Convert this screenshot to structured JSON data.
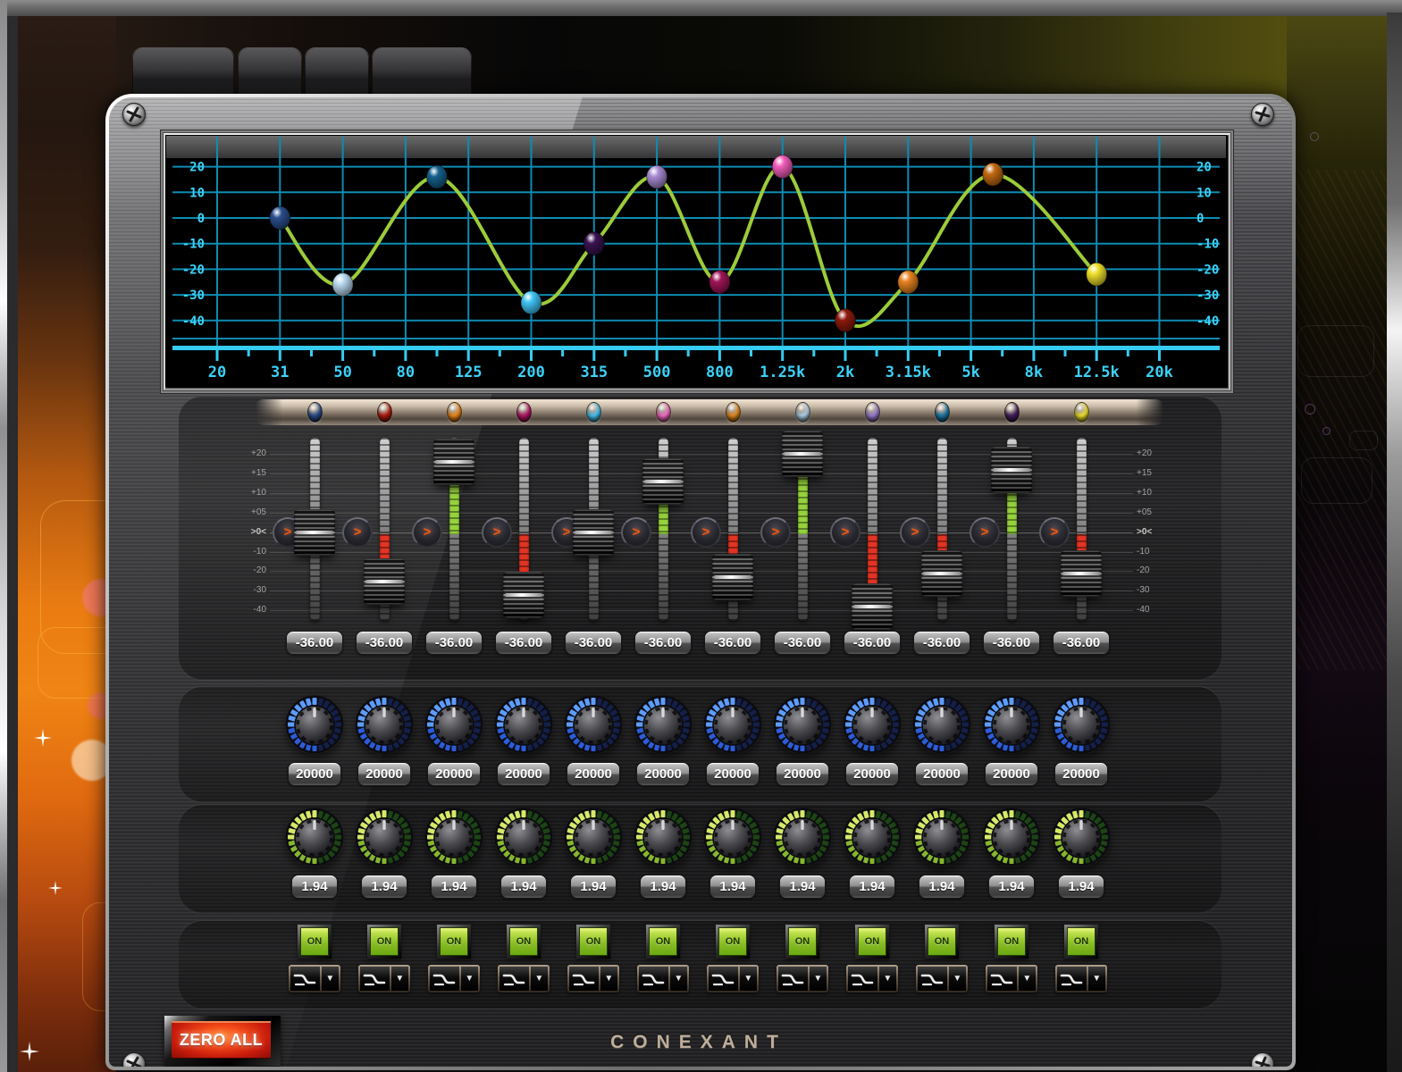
{
  "window": {
    "tabs": [
      {
        "label": ""
      },
      {
        "label": ""
      },
      {
        "label": ""
      },
      {
        "label": ""
      }
    ],
    "zero_all_label": "ZERO ALL",
    "brand": "CONEXANT"
  },
  "eq_scale": {
    "labels": [
      "+20",
      "+15",
      "+10",
      "+05",
      ">0<",
      "-10",
      "-20",
      "-30",
      "-40"
    ]
  },
  "chart_data": {
    "type": "line",
    "title": "",
    "xlabel": "",
    "ylabel": "",
    "x_ticks": [
      "20",
      "31",
      "50",
      "80",
      "125",
      "200",
      "315",
      "500",
      "800",
      "1.25k",
      "2k",
      "3.15k",
      "5k",
      "8k",
      "12.5k",
      "20k"
    ],
    "y_ticks": [
      "20",
      "10",
      "0",
      "-10",
      "-20",
      "-30",
      "-40"
    ],
    "ylim": [
      -50,
      30
    ],
    "grid": true,
    "legend": false,
    "curve_color": "#9ccc3a",
    "grid_color": "#0d8cb2",
    "axis_color": "#35ccf2",
    "label_color": "#3cd2f8",
    "points": [
      {
        "freq": "31",
        "tick": 1,
        "db": 0,
        "color": "#2a4e8c"
      },
      {
        "freq": "50",
        "tick": 2,
        "db": -26,
        "color": "#b8d8ee"
      },
      {
        "freq": "100",
        "tick": 3.5,
        "db": 16,
        "color": "#15608c"
      },
      {
        "freq": "200",
        "tick": 5,
        "db": -33,
        "color": "#40c4f4"
      },
      {
        "freq": "315",
        "tick": 6,
        "db": -10,
        "color": "#3a1252"
      },
      {
        "freq": "500",
        "tick": 7,
        "db": 16,
        "color": "#a88ad2"
      },
      {
        "freq": "800",
        "tick": 8,
        "db": -25,
        "color": "#a01458"
      },
      {
        "freq": "1.25k",
        "tick": 9,
        "db": 20,
        "color": "#f25cba"
      },
      {
        "freq": "2k",
        "tick": 10,
        "db": -40,
        "color": "#8c1a0c"
      },
      {
        "freq": "3.15k",
        "tick": 11,
        "db": -25,
        "color": "#e6821e"
      },
      {
        "freq": "6.3k",
        "tick": 12.35,
        "db": 17,
        "color": "#c26a12"
      },
      {
        "freq": "12.5k",
        "tick": 14,
        "db": -22,
        "color": "#eee02a"
      }
    ]
  },
  "bands": [
    {
      "id": 1,
      "led_color": "#2a4e8c",
      "slider_db": 0,
      "gain": "-36.00",
      "freq": "20000",
      "q": "1.94",
      "power": "ON"
    },
    {
      "id": 2,
      "led_color": "#b41c10",
      "slider_db": -25,
      "gain": "-36.00",
      "freq": "20000",
      "q": "1.94",
      "power": "ON"
    },
    {
      "id": 3,
      "led_color": "#f08818",
      "slider_db": 18,
      "gain": "-36.00",
      "freq": "20000",
      "q": "1.94",
      "power": "ON"
    },
    {
      "id": 4,
      "led_color": "#b61668",
      "slider_db": -32,
      "gain": "-36.00",
      "freq": "20000",
      "q": "1.94",
      "power": "ON"
    },
    {
      "id": 5,
      "led_color": "#46c2f2",
      "slider_db": 0,
      "gain": "-36.00",
      "freq": "20000",
      "q": "1.94",
      "power": "ON"
    },
    {
      "id": 6,
      "led_color": "#f66cc4",
      "slider_db": 13,
      "gain": "-36.00",
      "freq": "20000",
      "q": "1.94",
      "power": "ON"
    },
    {
      "id": 7,
      "led_color": "#e08a20",
      "slider_db": -23,
      "gain": "-36.00",
      "freq": "20000",
      "q": "1.94",
      "power": "ON"
    },
    {
      "id": 8,
      "led_color": "#aed2ea",
      "slider_db": 20,
      "gain": "-36.00",
      "freq": "20000",
      "q": "1.94",
      "power": "ON"
    },
    {
      "id": 9,
      "led_color": "#9a7ccc",
      "slider_db": -38,
      "gain": "-36.00",
      "freq": "20000",
      "q": "1.94",
      "power": "ON"
    },
    {
      "id": 10,
      "led_color": "#1e78a8",
      "slider_db": -21,
      "gain": "-36.00",
      "freq": "20000",
      "q": "1.94",
      "power": "ON"
    },
    {
      "id": 11,
      "led_color": "#46205e",
      "slider_db": 16,
      "gain": "-36.00",
      "freq": "20000",
      "q": "1.94",
      "power": "ON"
    },
    {
      "id": 12,
      "led_color": "#f0e42a",
      "slider_db": -21,
      "gain": "-36.00",
      "freq": "20000",
      "q": "1.94",
      "power": "ON"
    }
  ]
}
